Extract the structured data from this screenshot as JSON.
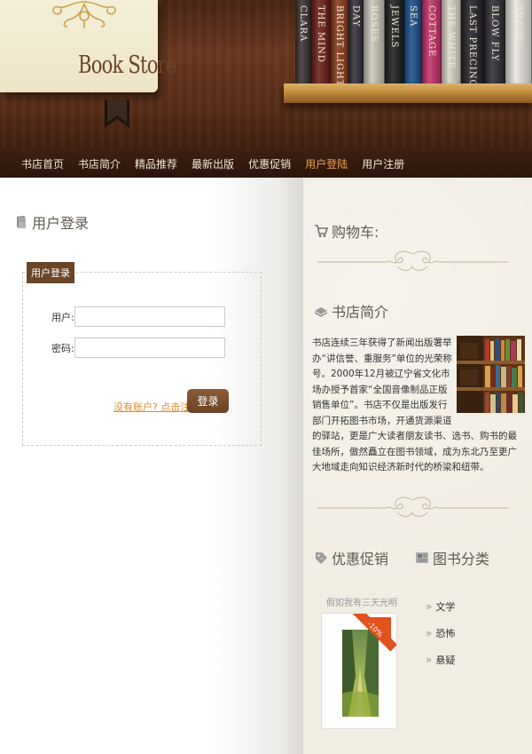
{
  "header": {
    "logo_title": "Book Store",
    "book_spines": [
      {
        "title": "CLARA",
        "color": "#3a3430"
      },
      {
        "title": "THE MIND",
        "color": "#6b1d1a"
      },
      {
        "title": "BRIGHT LIGHTS",
        "color": "#8a3a1c"
      },
      {
        "title": "DAY",
        "color": "#33303a"
      },
      {
        "title": "ROSES",
        "color": "#c9c6b8"
      },
      {
        "title": "JEWELS",
        "color": "#1e1e1e"
      },
      {
        "title": "SEA",
        "color": "#1a4e8a"
      },
      {
        "title": "COTTAGE",
        "color": "#c1326a"
      },
      {
        "title": "THE WHITE",
        "color": "#d9d4c4"
      },
      {
        "title": "LAST PRECINCT",
        "color": "#25232a"
      },
      {
        "title": "BLOW FLY",
        "color": "#2e2d33"
      },
      {
        "title": "TRACE",
        "color": "#e9e6df"
      }
    ]
  },
  "nav": {
    "items": [
      {
        "label": "书店首页",
        "active": false
      },
      {
        "label": "书店简介",
        "active": false
      },
      {
        "label": "精品推荐",
        "active": false
      },
      {
        "label": "最新出版",
        "active": false
      },
      {
        "label": "优惠促销",
        "active": false
      },
      {
        "label": "用户登陆",
        "active": true
      },
      {
        "label": "用户注册",
        "active": false
      }
    ],
    "active_color": "#f0a24a"
  },
  "login": {
    "section_title": "用户登录",
    "legend": "用户登录",
    "user_label": "用户:",
    "user_value": "",
    "password_label": "密码:",
    "password_value": "",
    "register_link": "没有账户? 点击注册",
    "login_button": "登录"
  },
  "cart": {
    "title": "购物车:"
  },
  "intro": {
    "title": "书店简介",
    "text": "书店连续三年获得了新闻出版署举办“讲信誉、重服务”单位的光荣称号。2000年12月被辽宁省文化市场办授予首家“全国音像制品正版销售单位”。书店不仅是出版发行部门开拓图书市场，开通货源渠道的驿站，更是广大读者朋友读书、选书、购书的最佳场所，傲然矗立在图书领域，成为东北乃至更广大地域走向知识经济新时代的桥梁和纽带。"
  },
  "promo": {
    "title": "优惠促销",
    "book_name": "假如我有三天光明",
    "discount_badge": "-10%",
    "badge_color": "#e0531e"
  },
  "categories": {
    "title": "图书分类",
    "items": [
      "文学",
      "恐怖",
      "悬疑"
    ]
  },
  "colors": {
    "brand_brown": "#6b4528",
    "link_orange": "#e08a2c"
  }
}
